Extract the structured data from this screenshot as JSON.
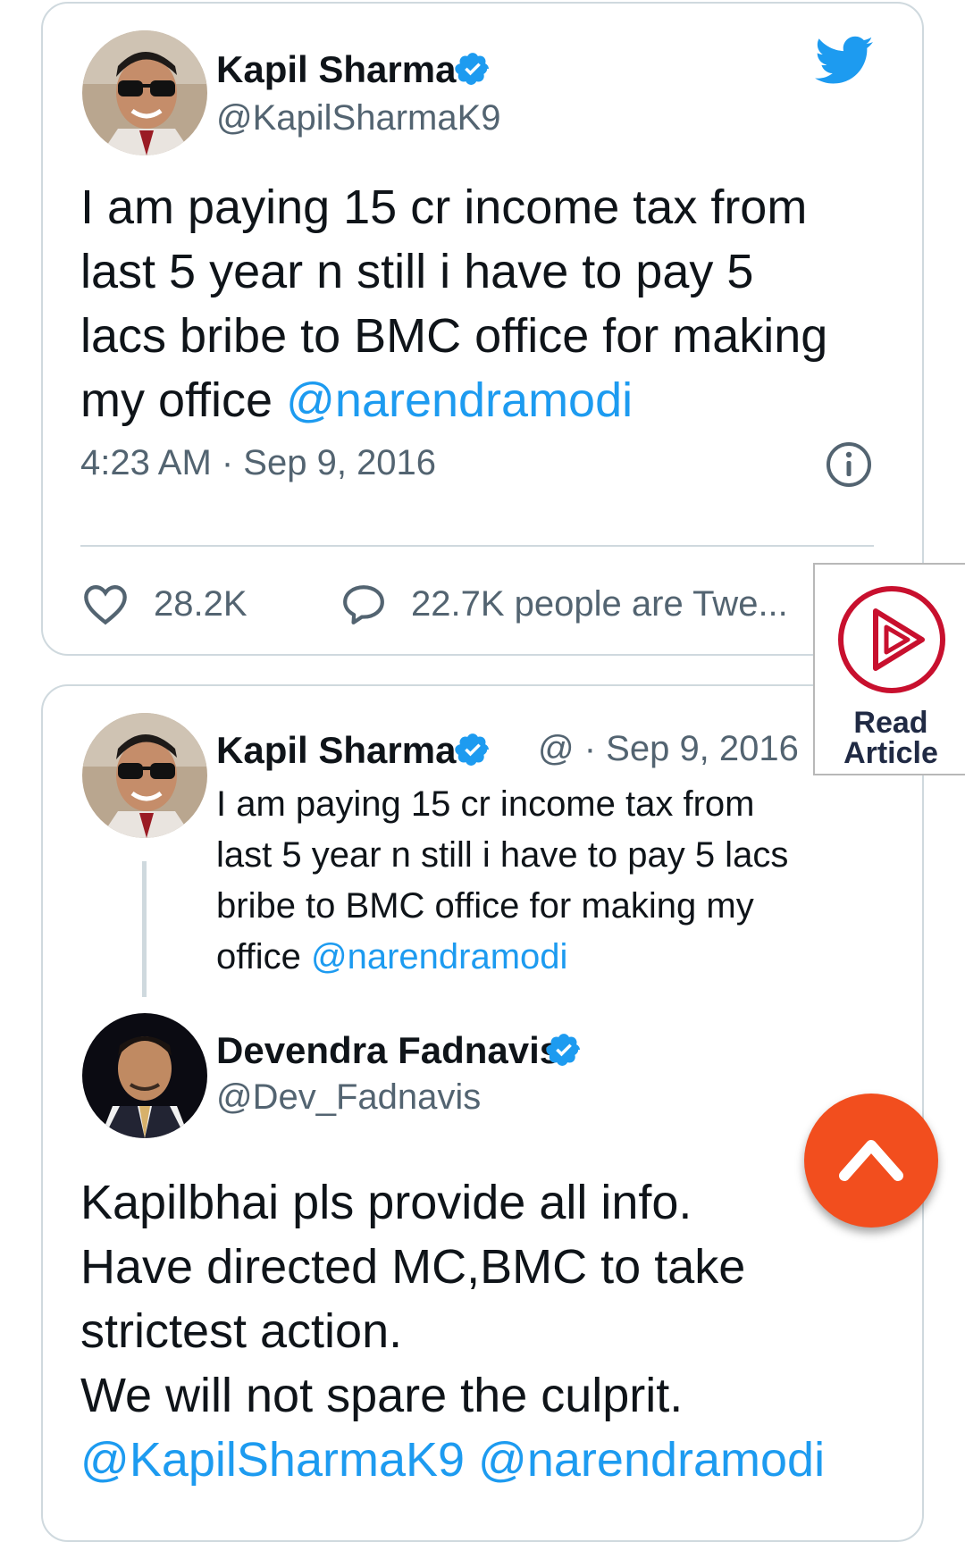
{
  "tweet": {
    "author_name": "Kapil Sharma",
    "author_handle": "@KapilSharmaK9",
    "text_line1": "I am paying 15 cr income tax from",
    "text_line2": "last 5 year n still i have to pay 5",
    "text_line3": "lacs bribe to BMC office for making",
    "text_line4_plain": "my office ",
    "text_mention": "@narendramodi",
    "time": "4:23 AM · Sep 9, 2016",
    "likes": "28.2K",
    "tweeting": "22.7K people are Twe..."
  },
  "quoted": {
    "author_name": "Kapil Sharma",
    "author_handle_date": "@ · Sep 9, 2016",
    "line1": "I am paying 15 cr income tax from",
    "line2": "last 5 year n still i have to pay 5 lacs",
    "line3": "bribe to BMC office for making my",
    "line4_plain": "office ",
    "mention": "@narendramodi"
  },
  "reply": {
    "author_name": "Devendra Fadnavis",
    "author_handle": "@Dev_Fadnavis",
    "line1": "Kapilbhai pls provide all info.",
    "line2": "Have directed MC,BMC to take",
    "line3": "strictest action.",
    "line4": "We will not spare the culprit.",
    "mention1": "@KapilSharmaK9",
    "mention2": "@narendramodi"
  },
  "widgets": {
    "read_article_line1": "Read",
    "read_article_line2": "Article"
  },
  "colors": {
    "twitter_blue": "#1d9bf0",
    "verified_blue": "#1d9bf0",
    "scroll_button": "#f24e1e",
    "read_article_red": "#c8102e"
  },
  "icons": [
    "twitter-bird-icon",
    "verified-badge-icon",
    "info-icon",
    "heart-icon",
    "comment-icon",
    "play-icon",
    "chevron-up-icon"
  ]
}
